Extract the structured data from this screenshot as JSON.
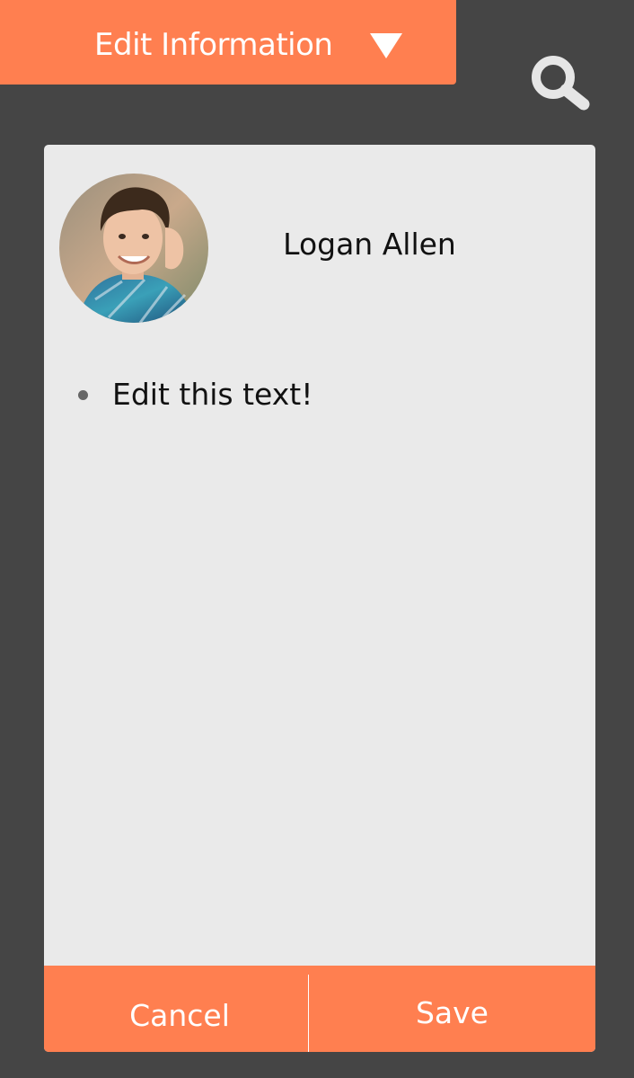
{
  "header": {
    "title": "Edit Information",
    "caret_icon": "triangle-down-icon",
    "accent_color": "#FF7F50"
  },
  "search": {
    "icon": "search-icon",
    "color": "#E6E6E6"
  },
  "profile": {
    "name": "Logan Allen",
    "avatar_icon": "profile-photo"
  },
  "notes": {
    "items": [
      "Edit this text!"
    ]
  },
  "actions": {
    "cancel_label": "Cancel",
    "save_label": "Save"
  },
  "colors": {
    "background": "#454545",
    "card": "#EAEAEA",
    "accent": "#FF7F50",
    "text": "#111111"
  }
}
